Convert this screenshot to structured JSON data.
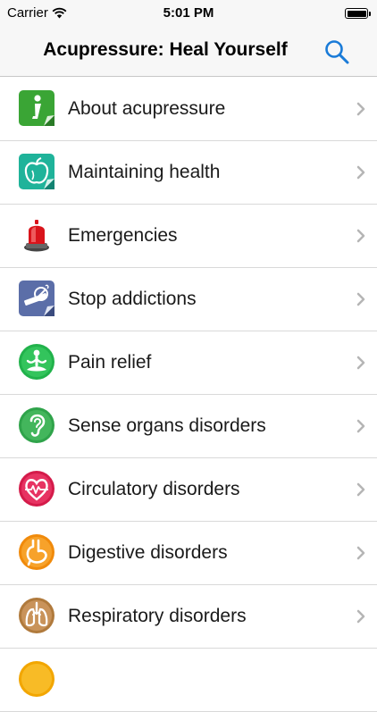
{
  "status_bar": {
    "carrier": "Carrier",
    "time": "5:01 PM"
  },
  "nav": {
    "title": "Acupressure: Heal Yourself",
    "search_icon": "search-icon"
  },
  "colors": {
    "accent": "#1a7bd8",
    "chevron": "#b5b5b5"
  },
  "menu": [
    {
      "label": "About acupressure",
      "icon": "info-icon"
    },
    {
      "label": "Maintaining health",
      "icon": "apple-icon"
    },
    {
      "label": "Emergencies",
      "icon": "siren-icon"
    },
    {
      "label": "Stop addictions",
      "icon": "no-smoking-icon"
    },
    {
      "label": "Pain relief",
      "icon": "meditation-icon"
    },
    {
      "label": "Sense organs disorders",
      "icon": "ear-icon"
    },
    {
      "label": "Circulatory disorders",
      "icon": "heart-icon"
    },
    {
      "label": "Digestive disorders",
      "icon": "stomach-icon"
    },
    {
      "label": "Respiratory disorders",
      "icon": "lungs-icon"
    }
  ]
}
